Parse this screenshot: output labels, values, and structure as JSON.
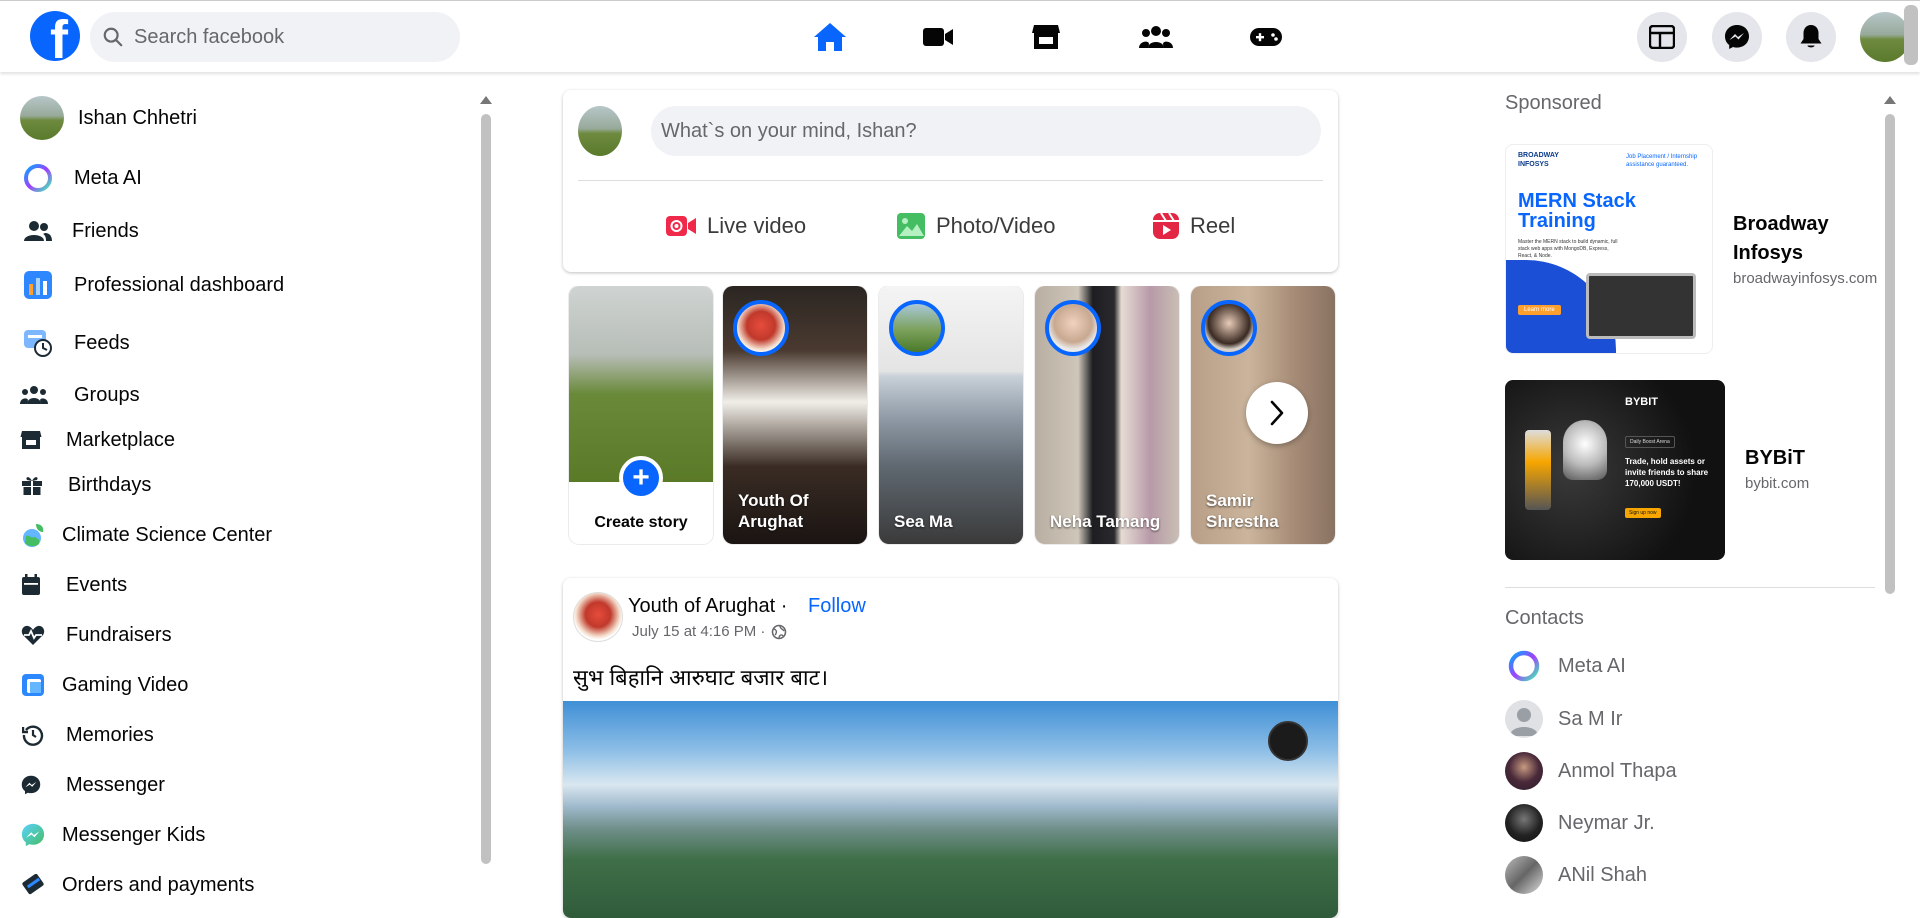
{
  "header": {
    "logo_letter": "f",
    "search_placeholder": "Search facebook",
    "nav": [
      "home",
      "video",
      "marketplace",
      "groups",
      "gaming"
    ],
    "right_icons": [
      "menu-grid",
      "messenger",
      "notifications",
      "profile"
    ]
  },
  "sidebar": {
    "user_name": "Ishan Chhetri",
    "items": [
      {
        "label": "Meta AI",
        "icon": "meta-ai-icon"
      },
      {
        "label": "Friends",
        "icon": "friends-icon"
      },
      {
        "label": "Professional dashboard",
        "icon": "dashboard-icon"
      },
      {
        "label": "Feeds",
        "icon": "feeds-icon"
      },
      {
        "label": "Groups",
        "icon": "groups-icon"
      },
      {
        "label": "Marketplace",
        "icon": "marketplace-icon"
      },
      {
        "label": "Birthdays",
        "icon": "birthday-icon"
      },
      {
        "label": "Climate Science Center",
        "icon": "climate-icon"
      },
      {
        "label": "Events",
        "icon": "events-icon"
      },
      {
        "label": "Fundraisers",
        "icon": "fundraisers-icon"
      },
      {
        "label": "Gaming Video",
        "icon": "gaming-video-icon"
      },
      {
        "label": "Memories",
        "icon": "memories-icon"
      },
      {
        "label": "Messenger",
        "icon": "messenger-icon"
      },
      {
        "label": "Messenger Kids",
        "icon": "messenger-kids-icon"
      },
      {
        "label": "Orders and payments",
        "icon": "orders-icon"
      }
    ]
  },
  "composer": {
    "placeholder": "What`s on your mind, Ishan?",
    "live_video": "Live video",
    "photo_video": "Photo/Video",
    "reel": "Reel"
  },
  "stories": {
    "create_label": "Create story",
    "items": [
      {
        "name": "Youth Of Arughat"
      },
      {
        "name": "Sea Ma"
      },
      {
        "name": "Neha Tamang"
      },
      {
        "name": "Samir Shrestha"
      }
    ]
  },
  "post": {
    "author": "Youth of Arughat ·",
    "follow": "Follow",
    "timestamp": "July 15 at 4:16 PM ·",
    "text": "सुभ बिहानि आरुघाट बजार बाट।"
  },
  "sponsored": {
    "title": "Sponsored",
    "ads": [
      {
        "name": "Broadway Infosys",
        "url": "broadwayinfosys.com",
        "image_title": "MERN Stack Training",
        "image_tag": "Job Placement / Internship assistance guaranteed.",
        "image_body": "Master the MERN stack to build dynamic, full stack web apps with MongoDB, Express, React, & Node.",
        "image_button": "Learn more",
        "image_brand": "BROADWAY INFOSYS"
      },
      {
        "name": "BYBiT",
        "url": "bybit.com",
        "image_brand": "BYBIT",
        "image_text": "Trade, hold assets or invite friends to share 170,000 USDT!",
        "image_button": "Sign up now",
        "image_small": "Daily Boost Arena"
      }
    ]
  },
  "contacts": {
    "title": "Contacts",
    "items": [
      {
        "name": "Meta AI"
      },
      {
        "name": "Sa M Ir"
      },
      {
        "name": "Anmol Thapa"
      },
      {
        "name": "Neymar Jr."
      },
      {
        "name": "ANil Shah"
      }
    ]
  },
  "colors": {
    "brand": "#0866ff",
    "live_video": "#f02849",
    "photo_video": "#45bd62",
    "reel": "#e42645"
  }
}
